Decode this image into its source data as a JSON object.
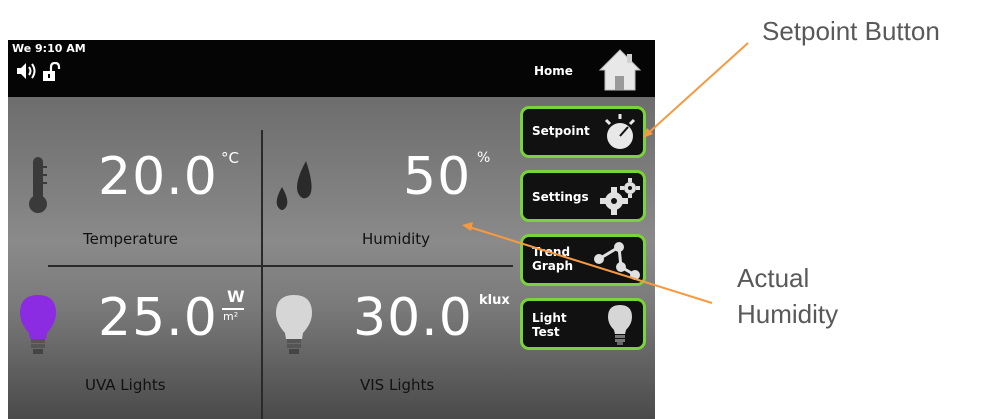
{
  "status": {
    "datetime": "We 9:10 AM",
    "home_label": "Home"
  },
  "tiles": {
    "temperature": {
      "value": "20.0",
      "unit": "°C",
      "label": "Temperature"
    },
    "humidity": {
      "value": "50",
      "unit": "%",
      "label": "Humidity"
    },
    "uva": {
      "value": "25.0",
      "unit_num": "W",
      "unit_den": "m²",
      "label": "UVA Lights"
    },
    "vis": {
      "value": "30.0",
      "unit": "klux",
      "label": "VIS Lights"
    }
  },
  "buttons": {
    "setpoint": "Setpoint",
    "settings": "Settings",
    "trend": [
      "Trend",
      "Graph"
    ],
    "light": [
      "Light",
      "Test"
    ]
  },
  "annotations": {
    "setpoint": "Setpoint Button",
    "humidity": [
      "Actual",
      "Humidity"
    ]
  },
  "colors": {
    "accent_green": "#7ad33a",
    "uva_bulb": "#8b2be2",
    "arrow": "#f59a42",
    "annotation_text": "#595959"
  },
  "icons": [
    "speaker-icon",
    "lock-icon",
    "home-icon",
    "thermometer-icon",
    "droplets-icon",
    "uva-bulb-icon",
    "vis-bulb-icon",
    "setpoint-dial-icon",
    "gears-icon",
    "trend-graph-icon",
    "light-bulb-icon"
  ]
}
